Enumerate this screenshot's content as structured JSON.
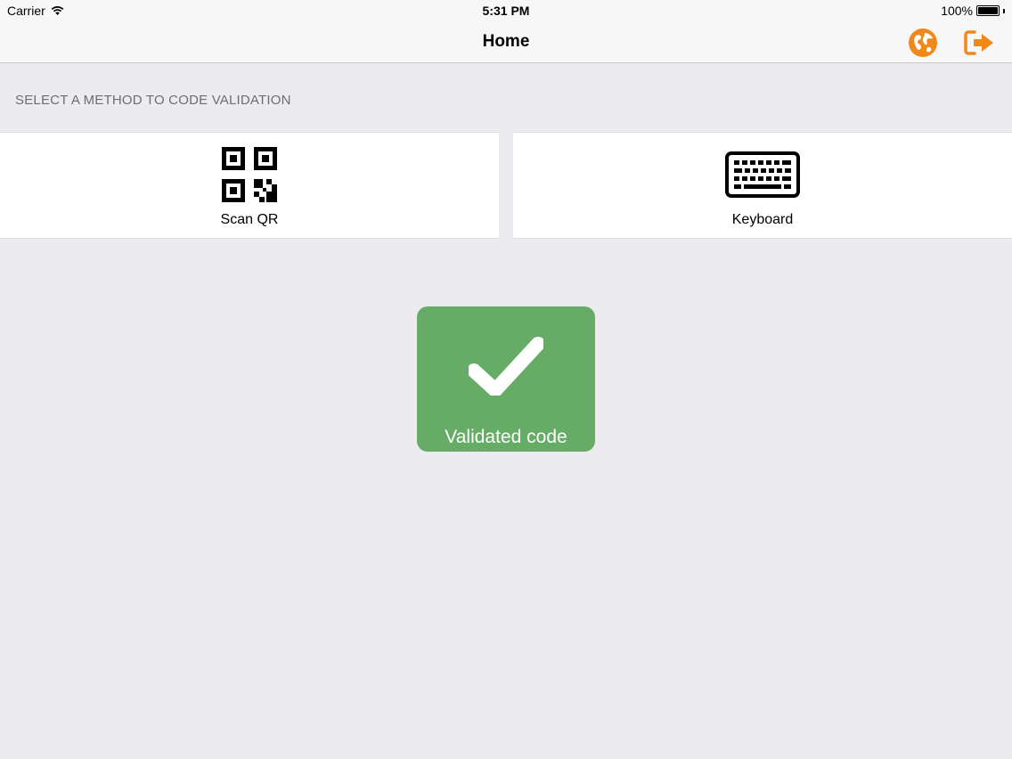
{
  "status_bar": {
    "carrier": "Carrier",
    "time": "5:31 PM",
    "battery": "100%"
  },
  "nav": {
    "title": "Home",
    "globe_icon": "globe-icon",
    "logout_icon": "logout-icon",
    "accent_color": "#f0891a"
  },
  "section": {
    "header": "SELECT A METHOD TO CODE VALIDATION"
  },
  "methods": [
    {
      "label": "Scan QR",
      "icon": "qr-code-icon"
    },
    {
      "label": "Keyboard",
      "icon": "keyboard-icon"
    }
  ],
  "validation": {
    "label": "Validated code",
    "icon": "checkmark-icon",
    "color": "#66ac66"
  }
}
